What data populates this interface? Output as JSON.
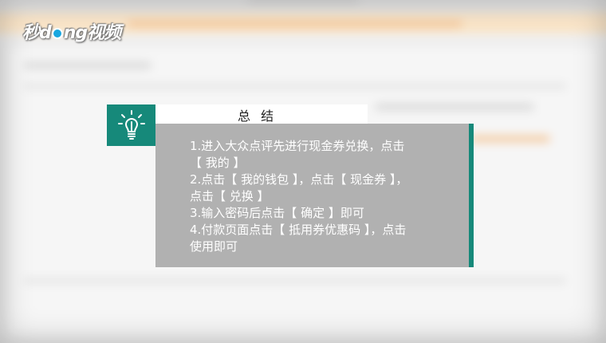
{
  "logo": {
    "text_pre": "秒d",
    "text_post": "ng视频"
  },
  "summary": {
    "title": "总 结",
    "lines": [
      "1.进入大众点评先进行现金券兑换，点击",
      "【 我的 】",
      "2.点击【 我的钱包 】，点击【 现金券 】，",
      "点击【 兑换 】",
      "3.输入密码后点击【 确定 】即可",
      "4.付款页面点击【 抵用券优惠码 】，点击",
      "使用即可"
    ]
  },
  "colors": {
    "accent": "#16897a",
    "panel": "#aaaaaa"
  },
  "icons": {
    "tip": "lightbulb-icon"
  }
}
